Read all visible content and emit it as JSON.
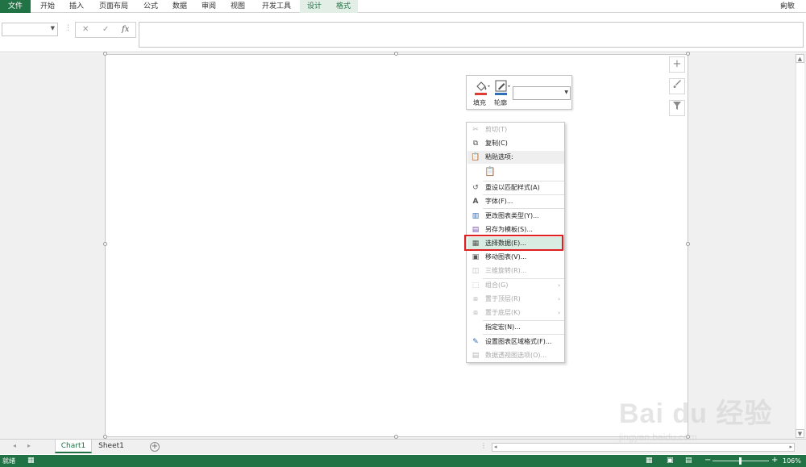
{
  "ribbon": {
    "file": "文件",
    "tabs": [
      "开始",
      "插入",
      "页面布局",
      "公式",
      "数据",
      "审阅",
      "视图",
      "开发工具"
    ],
    "context_tabs": [
      "设计",
      "格式"
    ],
    "user": "向敏"
  },
  "formula_bar": {
    "name_box_value": "",
    "cancel_icon": "✕",
    "enter_icon": "✓",
    "fx": "fx",
    "formula_value": ""
  },
  "side_tools": {
    "add_icon": "+",
    "brush_icon": "🖌",
    "filter_icon": "⊽"
  },
  "mini_toolbar": {
    "fill_label": "填充",
    "outline_label": "轮廓",
    "combo_value": ""
  },
  "context_menu": {
    "items": [
      {
        "label": "剪切(T)",
        "icon": "✂",
        "disabled": true
      },
      {
        "label": "复制(C)",
        "icon": "⧉",
        "disabled": false
      },
      {
        "label": "粘贴选项:",
        "icon": "📋",
        "disabled": false
      },
      {
        "label": "",
        "icon": "📋",
        "disabled": false
      },
      {
        "label": "重设以匹配样式(A)",
        "icon": "↺",
        "disabled": false
      },
      {
        "label": "字体(F)...",
        "icon": "A",
        "disabled": false
      },
      {
        "label": "更改图表类型(Y)...",
        "icon": "▥",
        "disabled": false
      },
      {
        "label": "另存为模板(S)...",
        "icon": "▤",
        "disabled": false
      },
      {
        "label": "选择数据(E)...",
        "icon": "▦",
        "disabled": false
      },
      {
        "label": "移动图表(V)...",
        "icon": "▣",
        "disabled": false
      },
      {
        "label": "三维旋转(R)...",
        "icon": "◫",
        "disabled": true
      },
      {
        "label": "组合(G)",
        "icon": "⬚",
        "disabled": true
      },
      {
        "label": "置于顶层(R)",
        "icon": "⧈",
        "disabled": true
      },
      {
        "label": "置于底层(K)",
        "icon": "⧈",
        "disabled": true
      },
      {
        "label": "指定宏(N)...",
        "icon": "",
        "disabled": false
      },
      {
        "label": "设置图表区域格式(F)...",
        "icon": "✎",
        "disabled": false
      },
      {
        "label": "数据透视图选项(O)...",
        "icon": "▤",
        "disabled": true
      }
    ],
    "submenu_arrow": "›"
  },
  "sheets": {
    "tabs": [
      "Chart1",
      "Sheet1"
    ],
    "active": "Chart1",
    "add_icon": "+"
  },
  "status_bar": {
    "status": "就绪",
    "zoom_minus": "−",
    "zoom_plus": "+",
    "zoom": "106%"
  },
  "watermark": {
    "logo": "Bai du 经验",
    "url": "jingyan.baidu.com"
  },
  "colors": {
    "accent": "#217346",
    "highlight": "#e02020",
    "menu_hover": "#d9ece1"
  }
}
